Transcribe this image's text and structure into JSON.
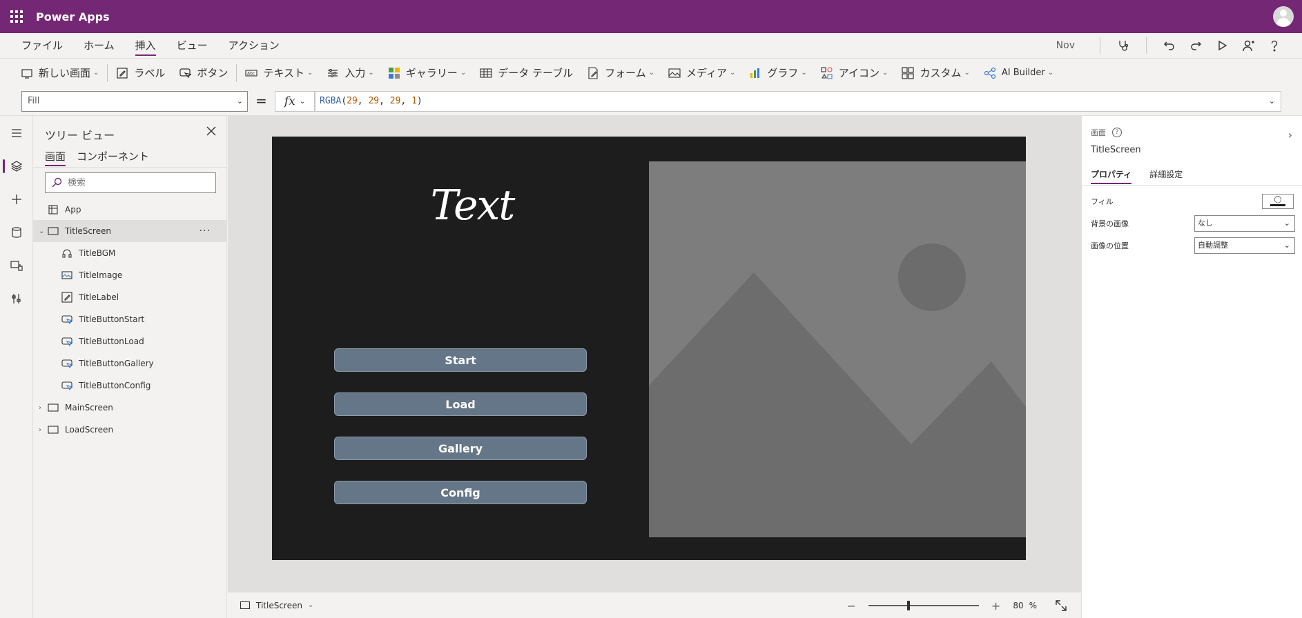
{
  "topbar": {
    "app_name": "Power Apps"
  },
  "menubar": {
    "items": [
      "ファイル",
      "ホーム",
      "挿入",
      "ビュー",
      "アクション"
    ],
    "active_index": 2,
    "user": "Nov",
    "icons": [
      "stethoscope-icon",
      "undo-icon",
      "redo-icon",
      "play-icon",
      "share-icon",
      "help-icon"
    ]
  },
  "ribbon": {
    "new_screen": "新しい画面",
    "label": "ラベル",
    "button": "ボタン",
    "text": "テキスト",
    "input": "入力",
    "gallery": "ギャラリー",
    "data_table": "データ テーブル",
    "form": "フォーム",
    "media": "メディア",
    "chart": "グラフ",
    "icons": "アイコン",
    "custom": "カスタム",
    "ai_builder": "AI Builder"
  },
  "formula": {
    "property": "Fill",
    "equals": "=",
    "fx": "fx",
    "fn": "RGBA",
    "open": "(",
    "r": "29",
    "g": "29",
    "b": "29",
    "a": "1",
    "sep": ", ",
    "close": ")"
  },
  "tree": {
    "title": "ツリー ビュー",
    "tabs": [
      "画面",
      "コンポーネント"
    ],
    "search_placeholder": "検索",
    "app": "App",
    "screen": "TitleScreen",
    "children": [
      "TitleBGM",
      "TitleImage",
      "TitleLabel",
      "TitleButtonStart",
      "TitleButtonLoad",
      "TitleButtonGallery",
      "TitleButtonConfig"
    ],
    "other_screens": [
      "MainScreen",
      "LoadScreen"
    ],
    "more": "···"
  },
  "canvas": {
    "background": "#1d1d1d",
    "title_label": "Text",
    "buttons": [
      "Start",
      "Load",
      "Gallery",
      "Config"
    ],
    "button_color": "#647687"
  },
  "statusbar": {
    "screen": "TitleScreen",
    "zoom_minus": "−",
    "zoom_plus": "+",
    "zoom": "80",
    "zoom_unit": "%",
    "zoom_level": 0.35
  },
  "props": {
    "type": "画面",
    "name": "TitleScreen",
    "tabs": [
      "プロパティ",
      "詳細設定"
    ],
    "fill_label": "フィル",
    "bg_image_label": "背景の画像",
    "bg_image_value": "なし",
    "image_pos_label": "画像の位置",
    "image_pos_value": "自動調整"
  },
  "colors": {
    "accent": "#742774",
    "button": "#647687",
    "screen_fill": "#1d1d1d"
  }
}
